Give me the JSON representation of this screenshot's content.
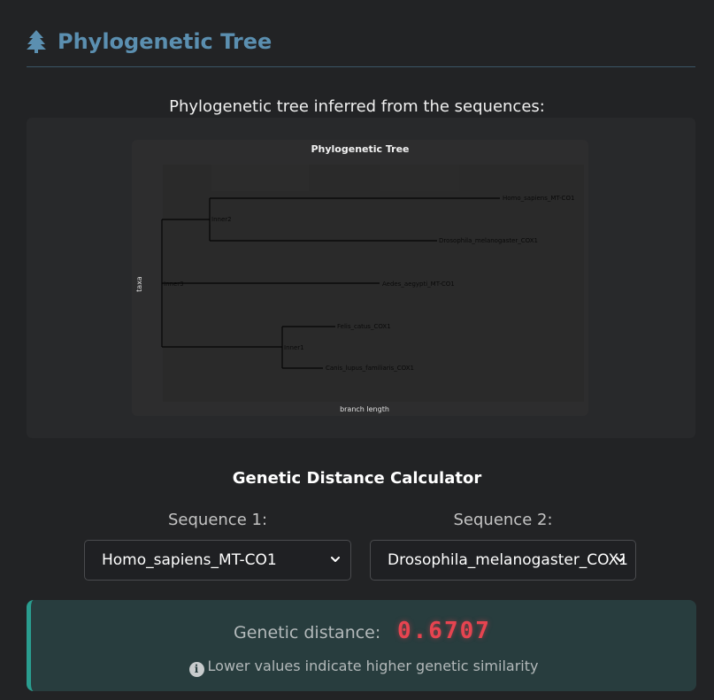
{
  "header": {
    "icon": "tree-icon",
    "title": "Phylogenetic Tree"
  },
  "tree_section": {
    "caption": "Phylogenetic tree inferred from the sequences:",
    "plot": {
      "title": "Phylogenetic Tree",
      "xlabel": "branch length",
      "ylabel": "taxa",
      "nodes": {
        "inner2": "Inner2",
        "inner3": "Inner3",
        "inner1": "Inner1"
      },
      "leaves": {
        "homo": "Homo_sapiens_MT-CO1",
        "droso": "Drosophila_melanogaster_COX1",
        "aedes": "Aedes_aegypti_MT-CO1",
        "felis": "Felis_catus_COX1",
        "canis": "Canis_lupus_familiaris_COX1"
      }
    }
  },
  "calculator": {
    "title": "Genetic Distance Calculator",
    "seq1_label": "Sequence 1:",
    "seq2_label": "Sequence 2:",
    "seq1_value": "Homo_sapiens_MT-CO1",
    "seq2_value": "Drosophila_melanogaster_COX1"
  },
  "result": {
    "label": "Genetic distance:",
    "value": "0.6707",
    "note": "Lower values indicate higher genetic similarity",
    "accent_color": "#2a9d8f",
    "value_color": "#e74450"
  },
  "colors": {
    "background": "#222325",
    "title": "#5b8fb0"
  }
}
